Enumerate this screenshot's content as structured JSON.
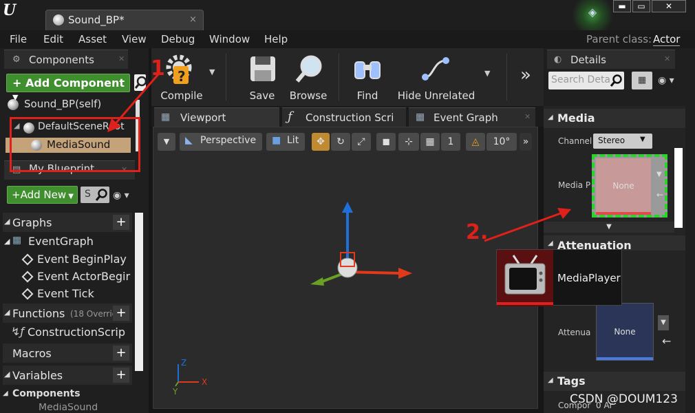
{
  "titlebar": {
    "tab_title": "Sound_BP*",
    "tab_close": "×",
    "window_min": "▬",
    "window_max": "▭",
    "window_close": "✕"
  },
  "menu": {
    "items": [
      "File",
      "Edit",
      "Asset",
      "View",
      "Debug",
      "Window",
      "Help"
    ],
    "parent_class_label": "Parent class:",
    "parent_class_value": "Actor"
  },
  "components_panel": {
    "title": "Components",
    "add_button": "Add Component",
    "search_icon": "🔍",
    "self_item": "Sound_BP(self)",
    "root_item": "DefaultSceneRoot",
    "child_item": "MediaSound"
  },
  "blueprint_panel": {
    "title": "My Blueprint",
    "add_button": "Add New",
    "search_placeholder": "S",
    "graphs_label": "Graphs",
    "event_graph": "EventGraph",
    "events": [
      "Event BeginPlay",
      "Event ActorBegir",
      "Event Tick"
    ],
    "functions_label": "Functions",
    "functions_note": "(18 Overric",
    "construction_script": "ConstructionScrip",
    "macros_label": "Macros",
    "variables_label": "Variables",
    "components_sub": "Components",
    "components_item": "MediaSound"
  },
  "toolbar": {
    "compile": "Compile",
    "save": "Save",
    "browse": "Browse",
    "find": "Find",
    "hide_unrelated": "Hide Unrelated",
    "more": "»"
  },
  "editor_tabs": [
    "Viewport",
    "Construction Scri",
    "Event Graph"
  ],
  "viewport": {
    "perspective": "Perspective",
    "lit": "Lit",
    "grid_snap": "1",
    "angle_snap": "10°",
    "more": "»"
  },
  "details_panel": {
    "title": "Details",
    "search_placeholder": "Search Deta",
    "media_category": "Media",
    "channels_label": "Channel",
    "channels_value": "Stereo",
    "media_player_label": "Media P",
    "media_player_value": "None",
    "attenuation_category": "Attenuation",
    "attenuation_label": "Attenua",
    "attenuation_value": "None",
    "tags_category": "Tags",
    "component_tags_label": "Compor",
    "component_tags_value": "0 Ar"
  },
  "drag_tooltip": {
    "label": "MediaPlayer"
  },
  "annotations": {
    "step1": "1",
    "step2": "2."
  },
  "watermark": "CSDN @DOUM123",
  "colors": {
    "accent_green": "#3f8f2f",
    "annotation_red": "#e0201a",
    "selection_tan": "#c4a27a"
  }
}
